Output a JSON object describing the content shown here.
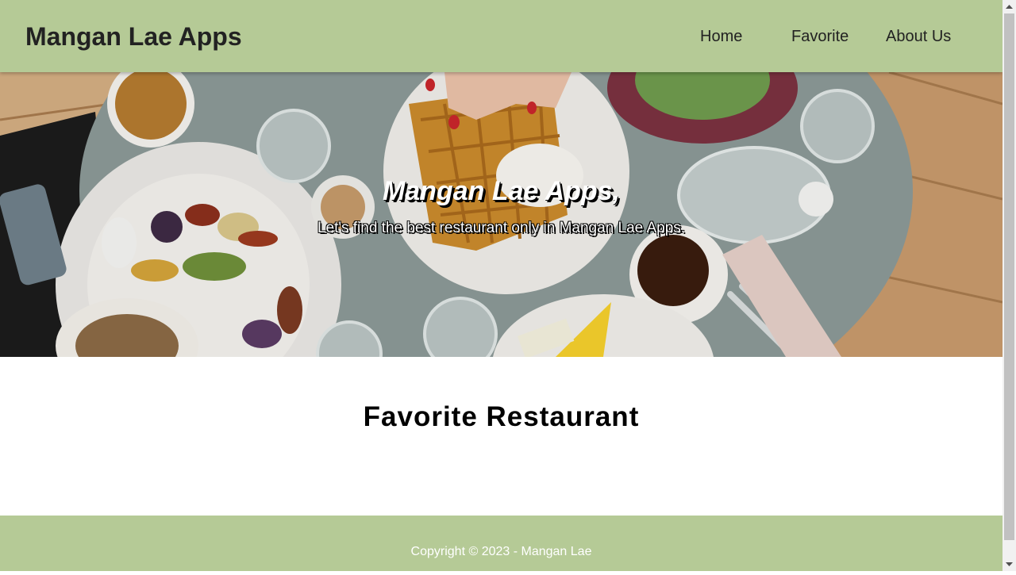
{
  "header": {
    "brand": "Mangan Lae Apps",
    "nav": [
      {
        "label": "Home"
      },
      {
        "label": "Favorite"
      },
      {
        "label": "About Us"
      }
    ]
  },
  "hero": {
    "title": "Mangan Lae Apps,",
    "subtitle": "Let's find the best restaurant only in Mangan Lae Apps."
  },
  "main": {
    "title": "Favorite Restaurant"
  },
  "footer": {
    "copyright": "Copyright © 2023 - Mangan Lae"
  },
  "colors": {
    "accent": "#b5ca96",
    "heading": "#222222"
  },
  "icons": {
    "scroll_up": "chevron-up-icon",
    "scroll_down": "chevron-down-icon"
  }
}
